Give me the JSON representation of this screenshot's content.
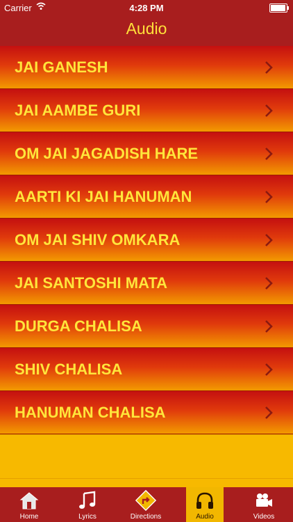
{
  "status_bar": {
    "carrier": "Carrier",
    "time": "4:28 PM",
    "battery_level": 0.95
  },
  "nav": {
    "title": "Audio"
  },
  "list": {
    "items": [
      {
        "label": "JAI GANESH"
      },
      {
        "label": "JAI AAMBE GURI"
      },
      {
        "label": "OM JAI JAGADISH HARE"
      },
      {
        "label": "AARTI KI JAI HANUMAN"
      },
      {
        "label": "OM JAI SHIV OMKARA"
      },
      {
        "label": "JAI SANTOSHI MATA"
      },
      {
        "label": "DURGA CHALISA"
      },
      {
        "label": "SHIV CHALISA"
      },
      {
        "label": "HANUMAN CHALISA"
      }
    ]
  },
  "tabs": [
    {
      "label": "Home",
      "icon": "home-icon"
    },
    {
      "label": "Lyrics",
      "icon": "music-note-icon"
    },
    {
      "label": "Directions",
      "icon": "directions-icon"
    },
    {
      "label": "Audio",
      "icon": "headphones-icon",
      "active": true
    },
    {
      "label": "Videos",
      "icon": "video-camera-icon"
    }
  ],
  "colors": {
    "bar_red": "#a81e1e",
    "label_yellow": "#ffe63b",
    "active_tab": "#f2b700",
    "chevron": "#8a1a10"
  }
}
